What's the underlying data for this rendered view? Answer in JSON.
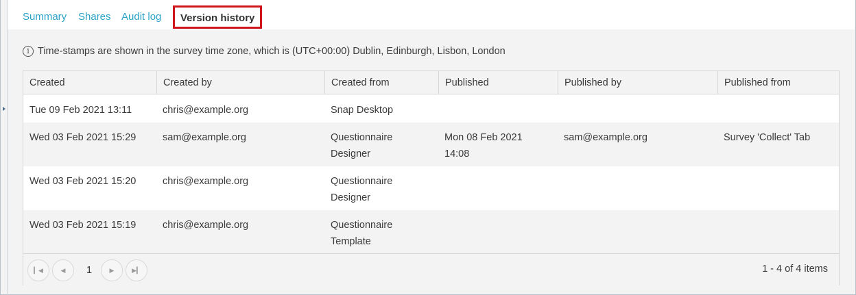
{
  "tabs": [
    {
      "label": "Summary"
    },
    {
      "label": "Shares"
    },
    {
      "label": "Audit log"
    },
    {
      "label": "Version history"
    }
  ],
  "notice": "Time-stamps are shown in the survey time zone, which is (UTC+00:00) Dublin, Edinburgh, Lisbon, London",
  "icons": {
    "info": "info-icon",
    "first": "first-page-icon",
    "prev": "previous-page-icon",
    "next": "next-page-icon",
    "last": "last-page-icon"
  },
  "table": {
    "columns": [
      "Created",
      "Created by",
      "Created from",
      "Published",
      "Published by",
      "Published from"
    ],
    "rows": [
      {
        "created": "Tue 09 Feb 2021 13:11",
        "created_by": "chris@example.org",
        "created_from": "Snap Desktop",
        "published": "",
        "published_by": "",
        "published_from": ""
      },
      {
        "created": "Wed 03 Feb 2021 15:29",
        "created_by": "sam@example.org",
        "created_from": "Questionnaire Designer",
        "published": "Mon 08 Feb 2021 14:08",
        "published_by": "sam@example.org",
        "published_from": "Survey 'Collect' Tab"
      },
      {
        "created": "Wed 03 Feb 2021 15:20",
        "created_by": "chris@example.org",
        "created_from": "Questionnaire Designer",
        "published": "",
        "published_by": "",
        "published_from": ""
      },
      {
        "created": "Wed 03 Feb 2021 15:19",
        "created_by": "chris@example.org",
        "created_from": "Questionnaire Template",
        "published": "",
        "published_by": "",
        "published_from": ""
      }
    ]
  },
  "pager": {
    "current_page": "1",
    "info": "1 - 4 of 4 items"
  },
  "colors": {
    "tab_link": "#2aa3c7",
    "active_outline": "#d0141c"
  }
}
